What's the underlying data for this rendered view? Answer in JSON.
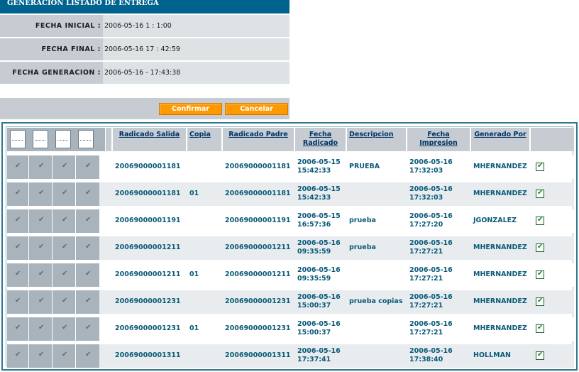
{
  "header": {
    "title": "GENERACION LISTADO DE ENTREGA"
  },
  "info": [
    {
      "label": "FECHA INICIAL :",
      "value": "2006-05-16 1 : 1:00"
    },
    {
      "label": "FECHA FINAL :",
      "value": "2006-05-16 17 : 42:59"
    },
    {
      "label": "FECHA GENERACION :",
      "value": "2006-05-16 - 17:43:38"
    }
  ],
  "buttons": {
    "confirm": "Confirmar",
    "cancel": "Cancelar"
  },
  "columns": {
    "radicado_salida": "Radicado Salida",
    "copia": "Copia",
    "radicado_padre": "Radicado Padre",
    "fecha_radicado": "Fecha Radicado",
    "descripcion": "Descripcion",
    "fecha_impresion": "Fecha Impresion",
    "generado_por": "Generado Por"
  },
  "header_icons": [
    "send-document-icon",
    "sign-document-icon",
    "print-icon",
    "envelope-icon"
  ],
  "rows": [
    {
      "radicado": "20069000001181",
      "copia": "",
      "padre": "20069000001181",
      "fecha_rad": "2006-05-15\n15:42:33",
      "desc": "PRUEBA",
      "fecha_imp": "2006-05-16\n17:32:03",
      "por": "MHERNANDEZ"
    },
    {
      "radicado": "20069000001181",
      "copia": "01",
      "padre": "20069000001181",
      "fecha_rad": "2006-05-15\n15:42:33",
      "desc": "",
      "fecha_imp": "2006-05-16\n17:32:03",
      "por": "MHERNANDEZ"
    },
    {
      "radicado": "20069000001191",
      "copia": "",
      "padre": "20069000001191",
      "fecha_rad": "2006-05-15\n16:57:36",
      "desc": "prueba",
      "fecha_imp": "2006-05-16\n17:27:20",
      "por": "JGONZALEZ"
    },
    {
      "radicado": "20069000001211",
      "copia": "",
      "padre": "20069000001211",
      "fecha_rad": "2006-05-16\n09:35:59",
      "desc": "prueba",
      "fecha_imp": "2006-05-16\n17:27:21",
      "por": "MHERNANDEZ"
    },
    {
      "radicado": "20069000001211",
      "copia": "01",
      "padre": "20069000001211",
      "fecha_rad": "2006-05-16\n09:35:59",
      "desc": "",
      "fecha_imp": "2006-05-16\n17:27:21",
      "por": "MHERNANDEZ"
    },
    {
      "radicado": "20069000001231",
      "copia": "",
      "padre": "20069000001231",
      "fecha_rad": "2006-05-16\n15:00:37",
      "desc": "prueba copias",
      "fecha_imp": "2006-05-16\n17:27:21",
      "por": "MHERNANDEZ"
    },
    {
      "radicado": "20069000001231",
      "copia": "01",
      "padre": "20069000001231",
      "fecha_rad": "2006-05-16\n15:00:37",
      "desc": "",
      "fecha_imp": "2006-05-16\n17:27:21",
      "por": "MHERNANDEZ"
    },
    {
      "radicado": "20069000001311",
      "copia": "",
      "padre": "20069000001311",
      "fecha_rad": "2006-05-16\n17:37:41",
      "desc": "",
      "fecha_imp": "2006-05-16\n17:38:40",
      "por": "HOLLMAN"
    }
  ],
  "colors": {
    "header_bg": "#00638f",
    "button": "#ff9900",
    "label_bg": "#c6ccd1",
    "link": "#0a5a78"
  }
}
